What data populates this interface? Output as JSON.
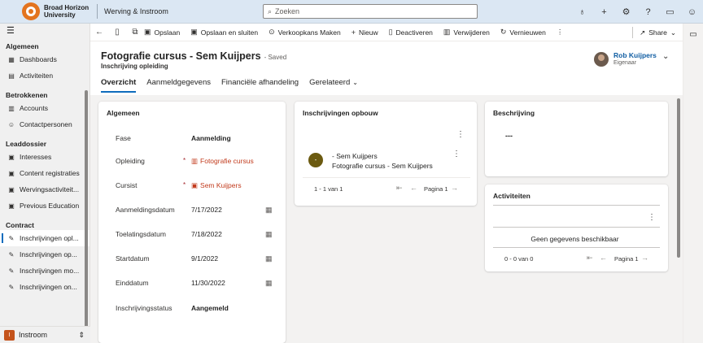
{
  "topbar": {
    "org_line1": "Broad Horizon",
    "org_line2": "University",
    "app_title": "Werving & Instroom",
    "search_placeholder": "Zoeken",
    "icons": [
      "lightbulb-icon",
      "plus-icon",
      "gear-icon",
      "help-icon",
      "chat-icon",
      "person-icon"
    ]
  },
  "nav": {
    "groups": [
      {
        "label": "Algemeen",
        "items": [
          {
            "label": "Dashboards",
            "icon": "dashboard-icon"
          },
          {
            "label": "Activiteiten",
            "icon": "activities-icon"
          }
        ]
      },
      {
        "label": "Betrokkenen",
        "items": [
          {
            "label": "Accounts",
            "icon": "account-icon"
          },
          {
            "label": "Contactpersonen",
            "icon": "contact-icon"
          }
        ]
      },
      {
        "label": "Leaddossier",
        "items": [
          {
            "label": "Interesses",
            "icon": "interest-icon"
          },
          {
            "label": "Content registraties",
            "icon": "content-icon"
          },
          {
            "label": "Wervingsactiviteit...",
            "icon": "recruit-icon"
          },
          {
            "label": "Previous Education",
            "icon": "education-icon"
          }
        ]
      },
      {
        "label": "Contract",
        "items": [
          {
            "label": "Inschrijvingen opl...",
            "icon": "edit-icon",
            "active": true
          },
          {
            "label": "Inschrijvingen op...",
            "icon": "edit-icon"
          },
          {
            "label": "Inschrijvingen mo...",
            "icon": "edit-icon"
          },
          {
            "label": "Inschrijvingen on...",
            "icon": "edit-icon"
          }
        ]
      }
    ],
    "area": {
      "badge": "I",
      "label": "Instroom"
    }
  },
  "commands": {
    "save": "Opslaan",
    "save_close": "Opslaan en sluiten",
    "opportunity": "Verkoopkans Maken",
    "new": "Nieuw",
    "deactivate": "Deactiveren",
    "delete": "Verwijderen",
    "refresh": "Vernieuwen",
    "share": "Share"
  },
  "record": {
    "title": "Fotografie cursus - Sem Kuijpers",
    "saved": "- Saved",
    "entity": "Inschrijving opleiding",
    "owner_name": "Rob Kuijpers",
    "owner_role": "Eigenaar"
  },
  "tabs": [
    "Overzicht",
    "Aanmeldgegevens",
    "Financiële afhandeling",
    "Gerelateerd"
  ],
  "general": {
    "title": "Algemeen",
    "fields": [
      {
        "label": "Fase",
        "value": "Aanmelding",
        "style": "bold"
      },
      {
        "label": "Opleiding",
        "value": "Fotografie cursus",
        "style": "link",
        "required": true,
        "icon": "book-icon"
      },
      {
        "label": "Cursist",
        "value": "Sem Kuijpers",
        "style": "link",
        "required": true,
        "icon": "contact-card-icon"
      },
      {
        "label": "Aanmeldingsdatum",
        "value": "7/17/2022",
        "calendar": true
      },
      {
        "label": "Toelatingsdatum",
        "value": "7/18/2022",
        "calendar": true
      },
      {
        "label": "Startdatum",
        "value": "9/1/2022",
        "calendar": true
      },
      {
        "label": "Einddatum",
        "value": "11/30/2022",
        "calendar": true
      },
      {
        "label": "Inschrijvingsstatus",
        "value": "Aangemeld",
        "style": "bold"
      }
    ]
  },
  "opbouw": {
    "title": "Inschrijvingen opbouw",
    "row_avatar": "-",
    "row_line1": "- Sem Kuijpers",
    "row_line2": "Fotografie cursus - Sem Kuijpers",
    "count": "1 - 1 van 1",
    "page": "Pagina 1"
  },
  "beschrijving": {
    "title": "Beschrijving",
    "value": "---"
  },
  "activiteiten": {
    "title": "Activiteiten",
    "empty": "Geen gegevens beschikbaar",
    "count": "0 - 0 van 0",
    "page": "Pagina 1"
  },
  "colors": {
    "accent": "#0f6cbd",
    "link": "#c23b1d",
    "brand": "#e3741f"
  }
}
